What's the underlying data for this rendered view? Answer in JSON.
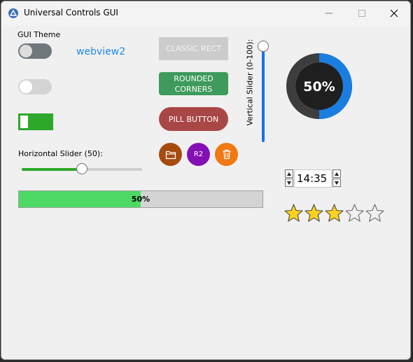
{
  "window": {
    "title": "Universal Controls GUI"
  },
  "controls": {
    "theme_label": "GUI Theme",
    "link_text": "webview2",
    "hslider_label": "Horizontal Slider (50):",
    "hslider_value": 50,
    "hslider_max": 100,
    "progress_text": "50%",
    "progress_value": 50,
    "vslider_label": "Vertical Slider (0-100):",
    "vslider_value": 100,
    "vslider_max": 100
  },
  "buttons": {
    "classic": "CLASSIC RECT",
    "rounded_line1": "ROUNDED",
    "rounded_line2": "CORNERS",
    "pill": "PILL BUTTON",
    "circle_r2": "R2"
  },
  "gauge": {
    "value": 50,
    "text": "50%"
  },
  "spinner": {
    "value": "14:35"
  },
  "rating": {
    "value": 3,
    "max": 5
  },
  "colors": {
    "toggle_on": "#2da82b",
    "progress_fill": "#4cd964",
    "gauge_arc": "#1a7ee0",
    "star_fill": "#ffd21f"
  },
  "icons": {
    "app": "app-icon",
    "folder": "folder-icon",
    "trash": "trash-icon",
    "star": "star-icon"
  }
}
